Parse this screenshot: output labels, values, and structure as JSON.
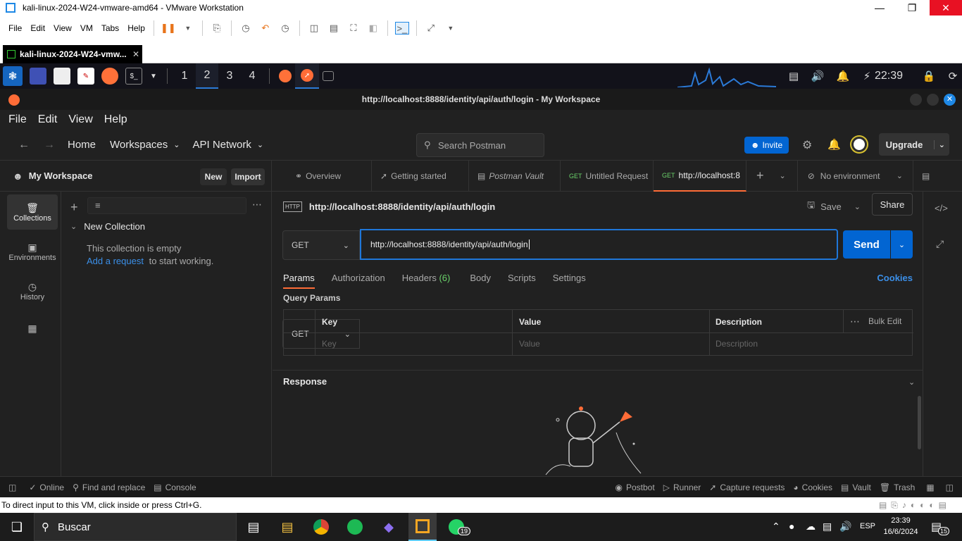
{
  "vmware": {
    "window_title": "kali-linux-2024-W24-vmware-amd64 - VMware Workstation",
    "menu": [
      "File",
      "Edit",
      "View",
      "VM",
      "Tabs",
      "Help"
    ],
    "tab_label": "kali-linux-2024-W24-vmw...",
    "status_text": "To direct input to this VM, click inside or press Ctrl+G."
  },
  "kali_panel": {
    "workspaces": [
      "1",
      "2",
      "3",
      "4"
    ],
    "active_workspace": "2",
    "clock": "22:39"
  },
  "postman": {
    "window_title": "http://localhost:8888/identity/api/auth/login - My Workspace",
    "menu": [
      "File",
      "Edit",
      "View",
      "Help"
    ],
    "nav": {
      "home": "Home",
      "workspaces": "Workspaces",
      "api_network": "API Network"
    },
    "search_placeholder": "Search Postman",
    "invite": "Invite",
    "upgrade": "Upgrade",
    "workspace_name": "My Workspace",
    "new_btn": "New",
    "import_btn": "Import",
    "rail": [
      "Collections",
      "Environments",
      "History"
    ],
    "collection": {
      "name": "New Collection",
      "empty_text": "This collection is empty",
      "add_link": "Add a request",
      "add_suffix": "to start working."
    },
    "tabs": [
      {
        "label": "Overview"
      },
      {
        "label": "Getting started"
      },
      {
        "label": "Postman Vault"
      },
      {
        "method": "GET",
        "label": "Untitled Request"
      },
      {
        "method": "GET",
        "label": "http://localhost:8"
      }
    ],
    "environment": "No environment",
    "request": {
      "title": "http://localhost:8888/identity/api/auth/login",
      "save": "Save",
      "share": "Share",
      "method": "GET",
      "url": "http://localhost:8888/identity/api/auth/login",
      "send": "Send",
      "subtabs": [
        "Params",
        "Authorization",
        "Headers",
        "Body",
        "Scripts",
        "Settings"
      ],
      "headers_count": "(6)",
      "cookies": "Cookies",
      "query_params": "Query Params",
      "columns": [
        "Key",
        "Value",
        "Description"
      ],
      "bulk_edit": "Bulk Edit",
      "placeholders": [
        "Key",
        "Value",
        "Description"
      ],
      "response": "Response"
    },
    "status_bar": {
      "online": "Online",
      "find": "Find and replace",
      "console": "Console",
      "postbot": "Postbot",
      "runner": "Runner",
      "capture": "Capture requests",
      "cookies": "Cookies",
      "vault": "Vault",
      "trash": "Trash"
    }
  },
  "windows": {
    "search": "Buscar",
    "language": "ESP",
    "time": "23:39",
    "date": "16/6/2024",
    "whatsapp_badge": "19",
    "notifications": "15"
  },
  "colors": {
    "accent_blue": "#0265d2",
    "postman_orange": "#ff6c37",
    "close_red": "#e81123"
  }
}
